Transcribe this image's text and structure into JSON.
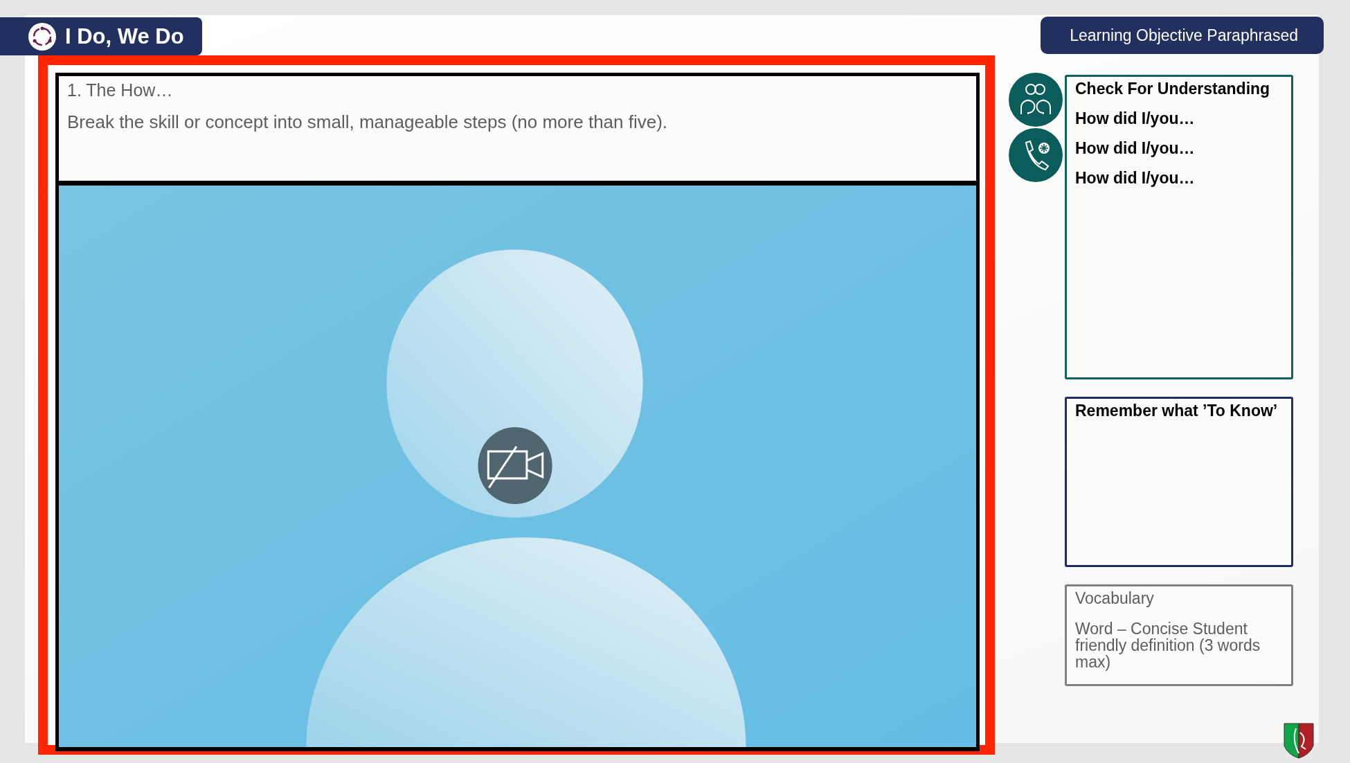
{
  "title_badge": {
    "text": "I Do, We Do"
  },
  "objective_badge": {
    "text": "Learning Objective Paraphrased"
  },
  "main_panel": {
    "heading": "1. The How…",
    "instruction": "Break the skill or concept into small, manageable steps (no more than five)."
  },
  "check_for_understanding": {
    "title": "Check For Understanding",
    "prompts": [
      "How did I/you…",
      "How did I/you…",
      "How did I/you…"
    ]
  },
  "remember": {
    "title": "Remember what ’To Know’"
  },
  "vocabulary": {
    "title": "Vocabulary",
    "definition": "Word – Concise Student friendly definition (3 words max)"
  }
}
